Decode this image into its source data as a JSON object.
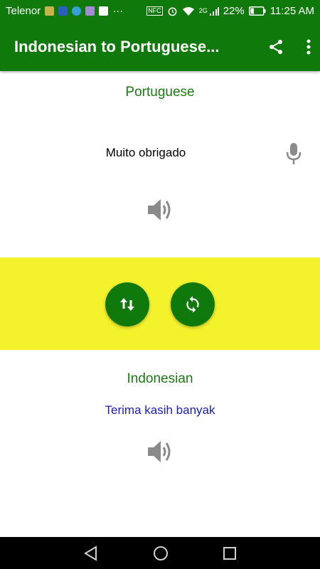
{
  "status_bar": {
    "carrier": "Telenor",
    "dots": "···",
    "signal_tag": "2G",
    "battery": "22%",
    "time": "11:25 AM"
  },
  "app_bar": {
    "title": "Indonesian to Portuguese...",
    "share_icon": "share-icon",
    "menu_icon": "more-vert-icon"
  },
  "source": {
    "language": "Portuguese",
    "text": "Muito obrigado",
    "mic_icon": "microphone-icon",
    "speak_icon": "speaker-icon"
  },
  "controls": {
    "swap_icon": "swap-arrows-icon",
    "refresh_icon": "refresh-icon",
    "band_color": "#f3f22d",
    "button_color": "#0f7a0b"
  },
  "target": {
    "language": "Indonesian",
    "text": "Terima kasih banyak",
    "speak_icon": "speaker-icon"
  },
  "nav": {
    "back_icon": "back-triangle-icon",
    "home_icon": "home-circle-icon",
    "recents_icon": "recents-square-icon"
  },
  "colors": {
    "primary": "#0f7a0b",
    "label_green": "#1a7a12",
    "translation_blue": "#1d20b8"
  }
}
